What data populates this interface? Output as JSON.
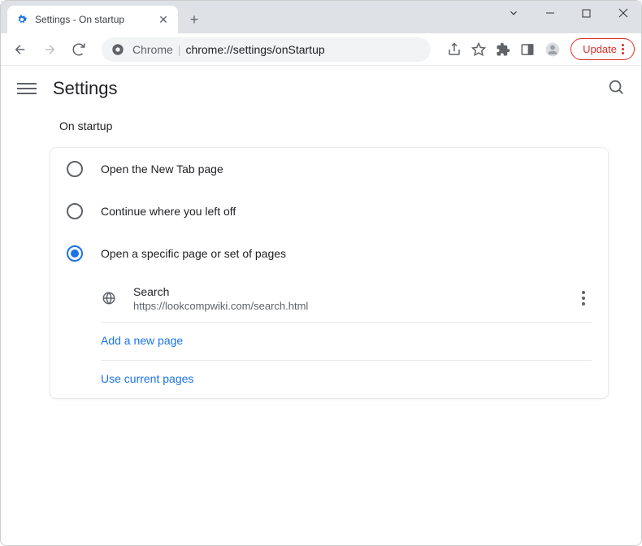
{
  "tab": {
    "title": "Settings - On startup"
  },
  "omnibox": {
    "prefix": "Chrome",
    "path": "chrome://settings/onStartup"
  },
  "updateBtn": "Update",
  "settings": {
    "title": "Settings"
  },
  "section": {
    "title": "On startup"
  },
  "radios": {
    "r0": "Open the New Tab page",
    "r1": "Continue where you left off",
    "r2": "Open a specific page or set of pages"
  },
  "page": {
    "name": "Search",
    "url": "https://lookcompwiki.com/search.html"
  },
  "links": {
    "add": "Add a new page",
    "current": "Use current pages"
  }
}
